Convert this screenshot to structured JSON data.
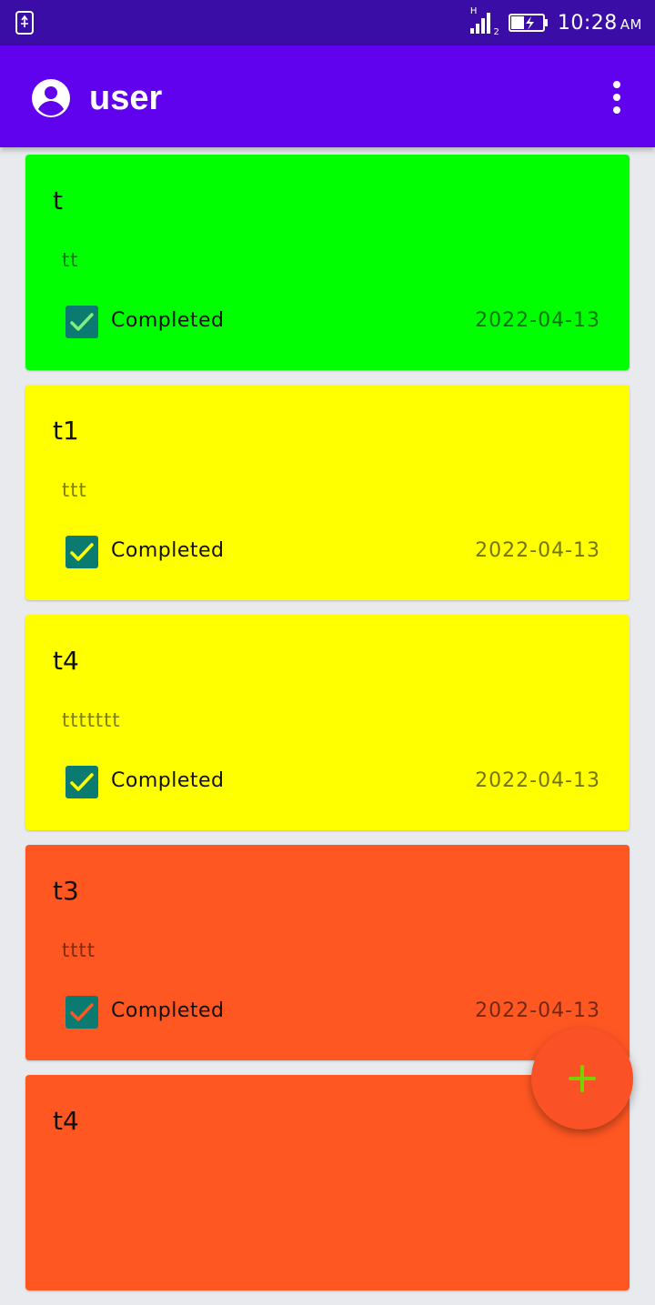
{
  "status_bar": {
    "time": "10:28",
    "am_pm": "AM",
    "network": "H",
    "sim": "2"
  },
  "app_bar": {
    "title": "user"
  },
  "tasks": [
    {
      "title": "t",
      "description": "tt",
      "status_label": "Completed",
      "date": "2022-04-13",
      "completed": true,
      "color": "#00ff00",
      "check_color": "#7ff07f"
    },
    {
      "title": "t1",
      "description": "ttt",
      "status_label": "Completed",
      "date": "2022-04-13",
      "completed": true,
      "color": "#ffff00",
      "check_color": "#ffff00"
    },
    {
      "title": "t4",
      "description": "ttttttt",
      "status_label": "Completed",
      "date": "2022-04-13",
      "completed": true,
      "color": "#ffff00",
      "check_color": "#ffff00"
    },
    {
      "title": "t3",
      "description": "tttt",
      "status_label": "Completed",
      "date": "2022-04-13",
      "completed": true,
      "color": "#ff5722",
      "check_color": "#ff5722"
    },
    {
      "title": "t4",
      "description": "",
      "status_label": "",
      "date": "",
      "completed": false,
      "color": "#ff5722",
      "check_color": "#ff5722"
    }
  ],
  "fab": {
    "icon": "plus-icon",
    "color": "#fa5226",
    "icon_color": "#7bd000"
  }
}
